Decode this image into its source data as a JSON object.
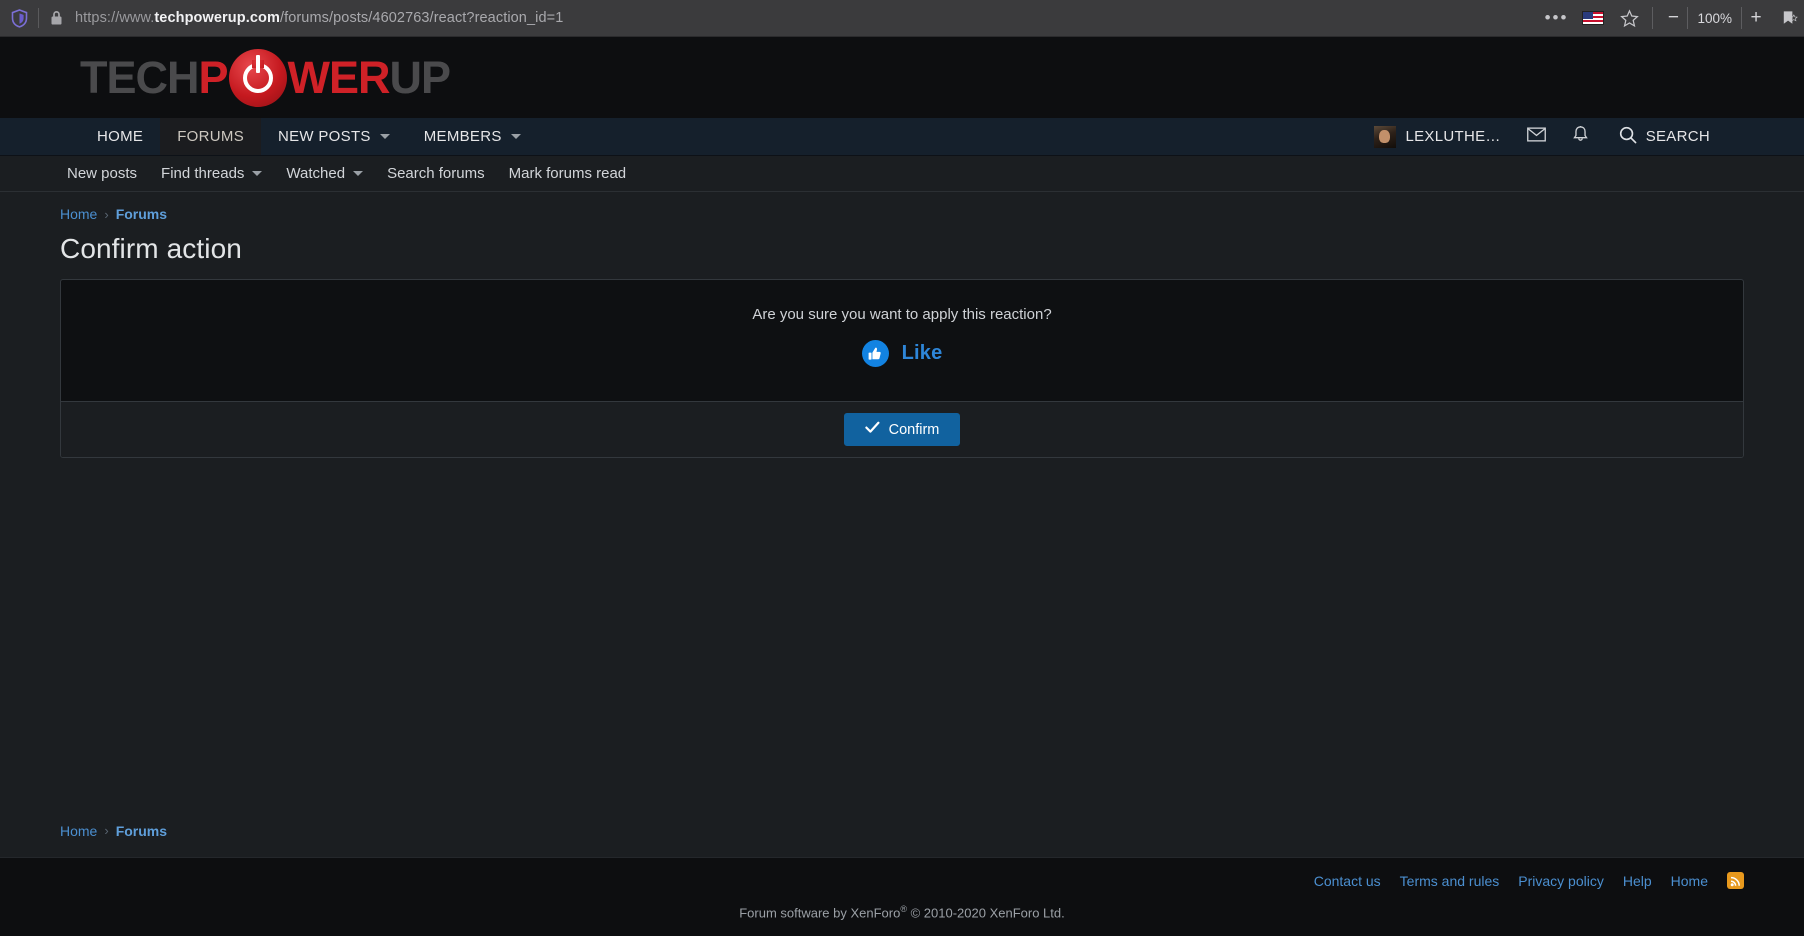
{
  "browser": {
    "shield_icon": "shield-icon",
    "lock_icon": "lock-icon",
    "url_scheme": "https://www.",
    "url_host": "techpowerup.com",
    "url_path": "/forums/posts/4602763/react?reaction_id=1",
    "menu_dots": "•••",
    "flag_icon": "us-flag-icon",
    "bookmark_star_icon": "star-icon",
    "zoom_out_label": "−",
    "zoom_level": "100%",
    "zoom_in_label": "+",
    "reading_list_icon": "reading-list-icon",
    "minimize_label": "−"
  },
  "logo": {
    "part1": "TECH",
    "part2": "P",
    "power_icon": "power-icon",
    "part3": "WER",
    "part4": "UP"
  },
  "mainnav": {
    "items": [
      {
        "label": "HOME",
        "has_caret": false,
        "active": false
      },
      {
        "label": "FORUMS",
        "has_caret": false,
        "active": true
      },
      {
        "label": "NEW POSTS",
        "has_caret": true,
        "active": false
      },
      {
        "label": "MEMBERS",
        "has_caret": true,
        "active": false
      }
    ],
    "username": "LEXLUTHE…",
    "avatar_icon": "avatar",
    "inbox_icon": "envelope-icon",
    "alerts_icon": "bell-icon",
    "search_icon": "search-icon",
    "search_label": "SEARCH"
  },
  "subnav": {
    "items": [
      {
        "label": "New posts",
        "has_caret": false
      },
      {
        "label": "Find threads",
        "has_caret": true
      },
      {
        "label": "Watched",
        "has_caret": true
      },
      {
        "label": "Search forums",
        "has_caret": false
      },
      {
        "label": "Mark forums read",
        "has_caret": false
      }
    ]
  },
  "breadcrumb": {
    "home": "Home",
    "separator": "›",
    "forums": "Forums"
  },
  "main": {
    "page_title": "Confirm action",
    "question": "Are you sure you want to apply this reaction?",
    "reaction_label": "Like",
    "reaction_icon": "thumbs-up-icon",
    "confirm_label": "Confirm",
    "confirm_icon": "check-icon"
  },
  "footer": {
    "links": [
      "Contact us",
      "Terms and rules",
      "Privacy policy",
      "Help",
      "Home"
    ],
    "rss_icon": "rss-icon",
    "copyright_pre": "Forum software by XenForo",
    "copyright_sup": "®",
    "copyright_post": " © 2010-2020 XenForo Ltd."
  },
  "colors": {
    "accent_blue": "#11629f",
    "link_blue": "#4b8fd0",
    "brand_red": "#cf2127",
    "nav_bg": "#15202c",
    "page_bg": "#1b1e21",
    "rss_orange": "#e8991d"
  }
}
